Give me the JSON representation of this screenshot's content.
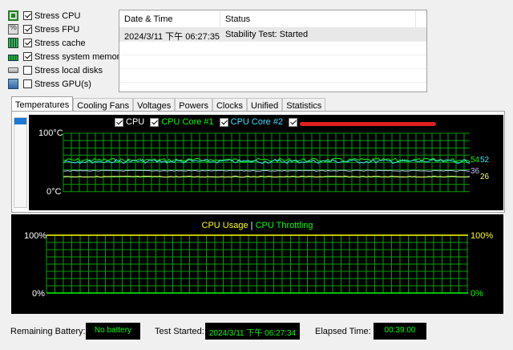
{
  "stress_options": [
    {
      "label": "Stress CPU",
      "checked": true,
      "icon": "cpu-icon"
    },
    {
      "label": "Stress FPU",
      "checked": true,
      "icon": "fpu-icon"
    },
    {
      "label": "Stress cache",
      "checked": true,
      "icon": "cache-icon"
    },
    {
      "label": "Stress system memory",
      "checked": true,
      "icon": "memory-icon"
    },
    {
      "label": "Stress local disks",
      "checked": false,
      "icon": "disk-icon"
    },
    {
      "label": "Stress GPU(s)",
      "checked": false,
      "icon": "gpu-icon"
    }
  ],
  "log": {
    "headers": {
      "date": "Date & Time",
      "status": "Status"
    },
    "rows": [
      {
        "date": "2024/3/11 下午 06:27:35",
        "status": "Stability Test: Started"
      }
    ]
  },
  "tabs": [
    {
      "label": "Temperatures",
      "active": true
    },
    {
      "label": "Cooling Fans",
      "active": false
    },
    {
      "label": "Voltages",
      "active": false
    },
    {
      "label": "Powers",
      "active": false
    },
    {
      "label": "Clocks",
      "active": false
    },
    {
      "label": "Unified",
      "active": false
    },
    {
      "label": "Statistics",
      "active": false
    }
  ],
  "temp_graph": {
    "legend": [
      {
        "label": "CPU",
        "color": "#ffffff"
      },
      {
        "label": "CPU Core #1",
        "color": "#00ff00"
      },
      {
        "label": "CPU Core #2",
        "color": "#40e0ff"
      }
    ],
    "y_max_label": "100°C",
    "y_min_label": "0°C",
    "y_range": [
      0,
      100
    ],
    "series": [
      {
        "name": "CPU Core #1",
        "color": "#00ff00",
        "value": 54,
        "label": "54"
      },
      {
        "name": "CPU Core #2",
        "color": "#40e0ff",
        "value": 52,
        "label": "52"
      },
      {
        "name": "CPU",
        "color": "#c0c0ff",
        "value": 36,
        "label": "36"
      },
      {
        "color": "#ffff80",
        "value": 26,
        "label": "26"
      }
    ],
    "grid_color": "#00a000"
  },
  "cpu_graph": {
    "title_usage": "CPU Usage",
    "title_sep": "|",
    "title_throttle": "CPU Throttling",
    "usage_color": "#ffff00",
    "throttle_color": "#00ff00",
    "left_max": "100%",
    "left_min": "0%",
    "right_max": "100%",
    "right_min": "0%"
  },
  "status": {
    "battery_label": "Remaining Battery:",
    "battery_value": "No battery",
    "started_label": "Test Started:",
    "started_value": "2024/3/11 下午 06:27:34",
    "elapsed_label": "Elapsed Time:",
    "elapsed_value": "00:39:00"
  }
}
